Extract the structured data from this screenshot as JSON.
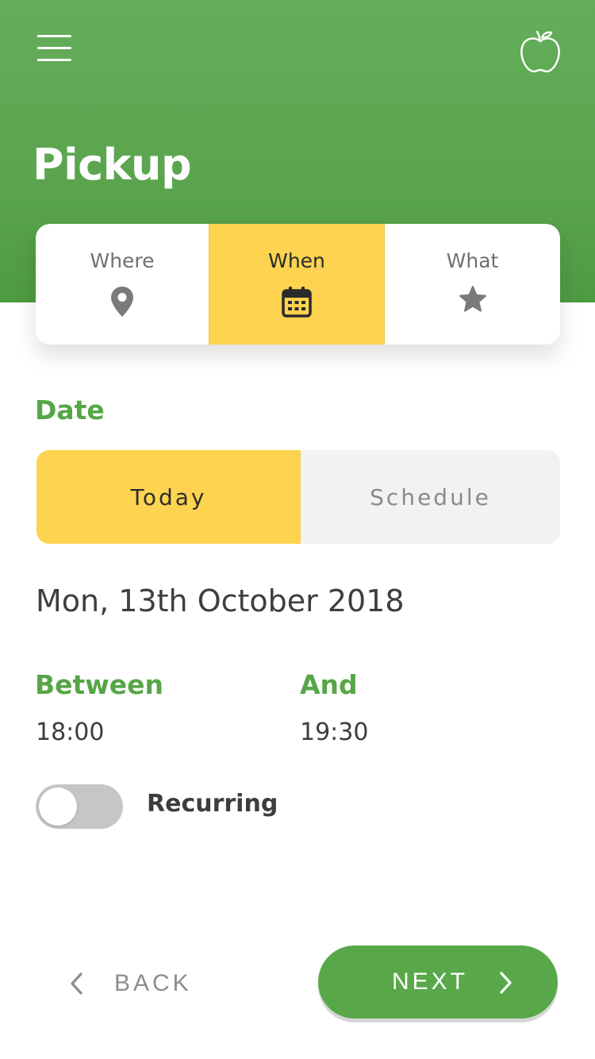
{
  "header": {
    "title": "Pickup",
    "menu_icon": "hamburger-menu-icon",
    "logo_icon": "apple-logo-icon",
    "background_color": "#5aa54d"
  },
  "tabs": [
    {
      "label": "Where",
      "icon": "map-pin-icon",
      "active": false
    },
    {
      "label": "When",
      "icon": "calendar-icon",
      "active": true
    },
    {
      "label": "What",
      "icon": "star-icon",
      "active": false
    }
  ],
  "date_section": {
    "title": "Date",
    "options": [
      {
        "label": "Today",
        "selected": true
      },
      {
        "label": "Schedule",
        "selected": false
      }
    ],
    "date_value": "Mon, 13th October 2018"
  },
  "time_section": {
    "between_label": "Between",
    "between_value": "18:00",
    "and_label": "And",
    "and_value": "19:30"
  },
  "recurring": {
    "label": "Recurring",
    "enabled": false
  },
  "footer": {
    "back_label": "BACK",
    "next_label": "NEXT"
  },
  "colors": {
    "accent_green": "#56a647",
    "accent_yellow": "#fdd34f",
    "text_dark": "#3d3d3d",
    "text_muted": "#8a8a8a"
  }
}
